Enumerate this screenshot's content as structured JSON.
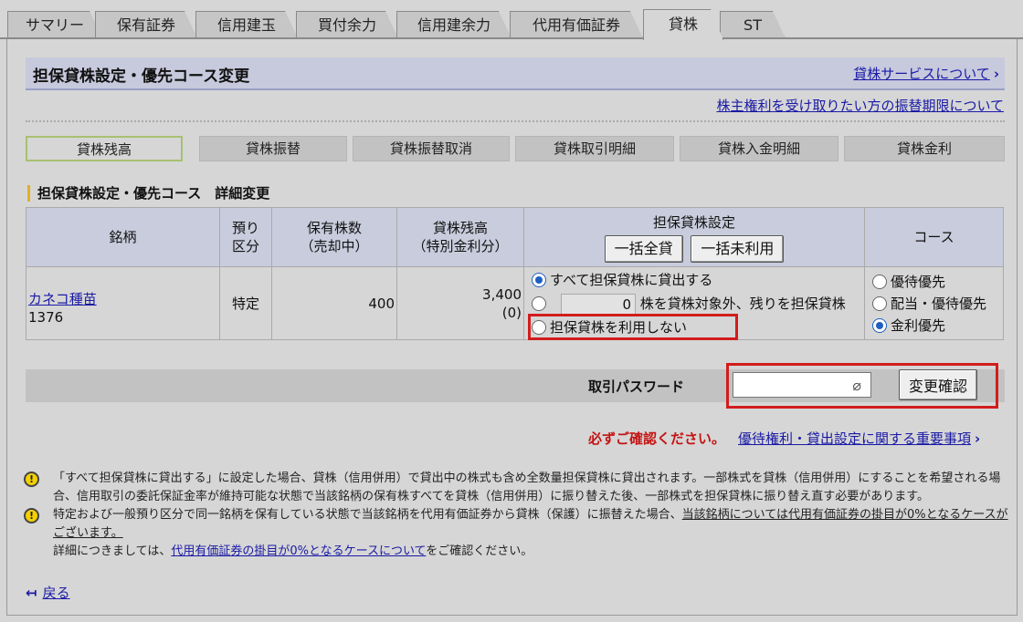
{
  "tabs": [
    "サマリー",
    "保有証券",
    "信用建玉",
    "買付余力",
    "信用建余力",
    "代用有価証券",
    "貸株",
    "ST"
  ],
  "active_tab": "貸株",
  "header": {
    "title": "担保貸株設定・優先コース変更",
    "service_link": "貸株サービスについて"
  },
  "rights_link": "株主権利を受け取りたい方の振替期限について",
  "subtabs": [
    "貸株残高",
    "貸株振替",
    "貸株振替取消",
    "貸株取引明細",
    "貸株入金明細",
    "貸株金利"
  ],
  "section_title": "担保貸株設定・優先コース　詳細変更",
  "table": {
    "headers": {
      "stock": "銘柄",
      "deposit_1": "預り",
      "deposit_2": "区分",
      "shares_1": "保有株数",
      "shares_2": "（売却中）",
      "balance_1": "貸株残高",
      "balance_2": "（特別金利分）",
      "setting": "担保貸株設定",
      "course": "コース"
    },
    "bulk_all": "一括全貸",
    "bulk_none": "一括未利用",
    "row": {
      "stock_name": "カネコ種苗",
      "stock_code": "1376",
      "deposit": "特定",
      "shares": "400",
      "balance": "3,400",
      "balance_special": "(0)",
      "opt_all": "すべて担保貸株に貸出する",
      "opt_partial_value": "0",
      "opt_partial_text": "株を貸株対象外、残りを担保貸株",
      "opt_none": "担保貸株を利用しない",
      "course_opt1": "優待優先",
      "course_opt2": "配当・優待優先",
      "course_opt3": "金利優先"
    }
  },
  "password": {
    "label": "取引パスワード",
    "confirm": "変更確認"
  },
  "notice": {
    "red": "必ずご確認ください。",
    "link": "優待権利・貸出設定に関する重要事項"
  },
  "notes": {
    "note1": "「すべて担保貸株に貸出する」に設定した場合、貸株（信用併用）で貸出中の株式も含め全数量担保貸株に貸出されます。一部株式を貸株（信用併用）にすることを希望される場合、信用取引の委託保証金率が維持可能な状態で当該銘柄の保有株すべてを貸株（信用併用）に振り替えた後、一部株式を担保貸株に振り替え直す必要があります。",
    "note2_a": "特定および一般預り区分で同一銘柄を保有している状態で当該銘柄を代用有価証券から貸株（保護）に振替えた場合、",
    "note2_b": "当該銘柄については代用有価証券の掛目が0%となるケースがございます。",
    "note2_c": "詳細につきましては、",
    "note2_link": "代用有価証券の掛目が0%となるケースについて",
    "note2_d": "をご確認ください。"
  },
  "back": "戻る"
}
